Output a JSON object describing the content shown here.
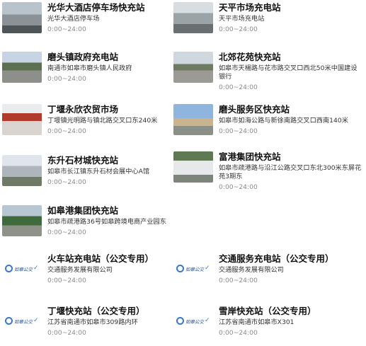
{
  "stations": [
    {
      "title": "光华大酒店停车场快充站",
      "address": "光华大酒店停车场",
      "hours": "0:00~24:00",
      "thumb": "photo"
    },
    {
      "title": "天平市场充电站",
      "address": "天平市场充电站",
      "hours": "0:00~24:00",
      "thumb": "photo"
    },
    {
      "title": "磨头镇政府充电站",
      "address": "南通市如皋市磨头镇人民政府",
      "hours": "0:00~24:00",
      "thumb": "photo"
    },
    {
      "title": "北郊花苑快充站",
      "address": "如皋市天楊路与花市路交叉口西北50米中国建设银行",
      "hours": "0:00~24:00",
      "thumb": "photo"
    },
    {
      "title": "丁堰永欣农贸市场",
      "address": "丁堰镇光明路与镇北路交叉口东240米",
      "hours": "0:00~24:00",
      "thumb": "photo"
    },
    {
      "title": "磨头服务区快充站",
      "address": "如皋市如海公路与新徐南路交叉口西南140米",
      "hours": "0:00~24:00",
      "thumb": "photo"
    },
    {
      "title": "东升石材城快充站",
      "address": "如皋市长江镇东升石材会展中心A馆",
      "hours": "0:00~24:00",
      "thumb": "photo"
    },
    {
      "title": "富港集团快充站",
      "address": "如皋市疏港路与沿江公路交叉口东北300米东屏花苑3期东",
      "hours": "0:00~24:00",
      "thumb": "photo"
    },
    {
      "title": "如皋港集团快充站",
      "address": "如皋市疏港路36号如皋跨境电商产业园东",
      "hours": "0:00~24:00",
      "thumb": "photo"
    },
    {
      "title": "火车站充电站（公交专用）",
      "address": "交通服务发展有限公司",
      "hours": "0:00~24:00",
      "thumb": "logo"
    },
    {
      "title": "交通服务充电站（公交专用）",
      "address": "交通服务发展有限公司",
      "hours": "0:00~24:00",
      "thumb": "logo"
    },
    {
      "title": "丁堰快充站（公交专用）",
      "address": "江苏省南通市如皋市309路内环",
      "hours": "0:00~24:00",
      "thumb": "logo"
    },
    {
      "title": "雪岸快充站（公交专用）",
      "address": "江苏省南通市如皋市X301",
      "hours": "0:00~24:00",
      "thumb": "logo"
    }
  ],
  "logo": {
    "text": "如皋公交",
    "icon": "bus-company-logo"
  }
}
